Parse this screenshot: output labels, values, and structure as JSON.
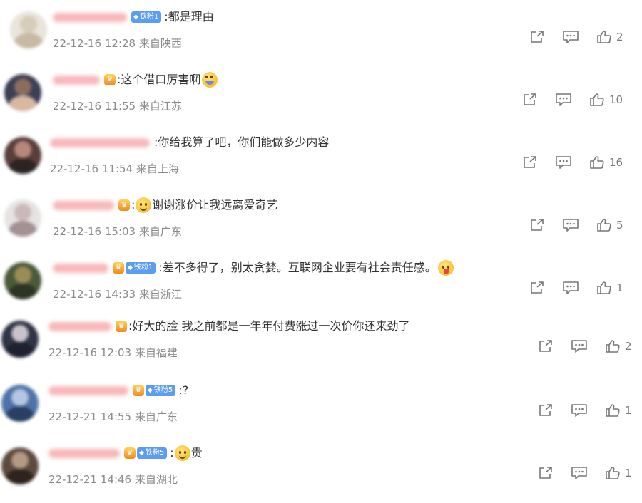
{
  "comments": [
    {
      "fan_badge": "铁粉1",
      "crown": false,
      "text": ":都是理由",
      "emoji": "",
      "emoji_pos": "none",
      "time": "22-12-16 12:28",
      "location": "来自陕西",
      "likes": "2"
    },
    {
      "fan_badge": "",
      "crown": true,
      "text": ":这个借口厉害啊",
      "emoji": "laugh",
      "emoji_pos": "after",
      "time": "22-12-16 11:55",
      "location": "来自江苏",
      "likes": "10"
    },
    {
      "fan_badge": "",
      "crown": false,
      "text": ":你给我算了吧，你们能做多少内容",
      "emoji": "",
      "emoji_pos": "none",
      "time": "22-12-16 11:54",
      "location": "来自上海",
      "likes": "16"
    },
    {
      "fan_badge": "",
      "crown": true,
      "text": "谢谢涨价让我远离爱奇艺",
      "emoji": "smile",
      "emoji_pos": "before",
      "time": "22-12-16 15:03",
      "location": "来自广东",
      "likes": "5"
    },
    {
      "fan_badge": "铁粉1",
      "crown": true,
      "text": ":差不多得了，别太贪婪。互联网企业要有社会责任感。",
      "emoji": "tongue",
      "emoji_pos": "after",
      "time": "22-12-16 14:33",
      "location": "来自浙江",
      "likes": "1"
    },
    {
      "fan_badge": "",
      "crown": true,
      "text": ":好大的脸 我之前都是一年年付费涨过一次价你还来劲了",
      "emoji": "",
      "emoji_pos": "none",
      "time": "22-12-16 12:03",
      "location": "来自福建",
      "likes": "2"
    },
    {
      "fan_badge": "铁粉5",
      "crown": true,
      "text": ":?",
      "emoji": "",
      "emoji_pos": "none",
      "time": "22-12-21 14:55",
      "location": "来自广东",
      "likes": "1"
    },
    {
      "fan_badge": "铁粉5",
      "crown": true,
      "text": "贵",
      "emoji": "smile",
      "emoji_pos": "before",
      "time": "22-12-21 14:46",
      "location": "来自湖北",
      "likes": "1"
    }
  ],
  "icons": {
    "share": "share-icon",
    "reply": "comment-icon",
    "like": "thumbs-up-icon"
  },
  "colors": {
    "fan_badge": "#5b9df0",
    "meta_text": "#8a8a8a",
    "blurred_name": "#f7b8b8"
  }
}
